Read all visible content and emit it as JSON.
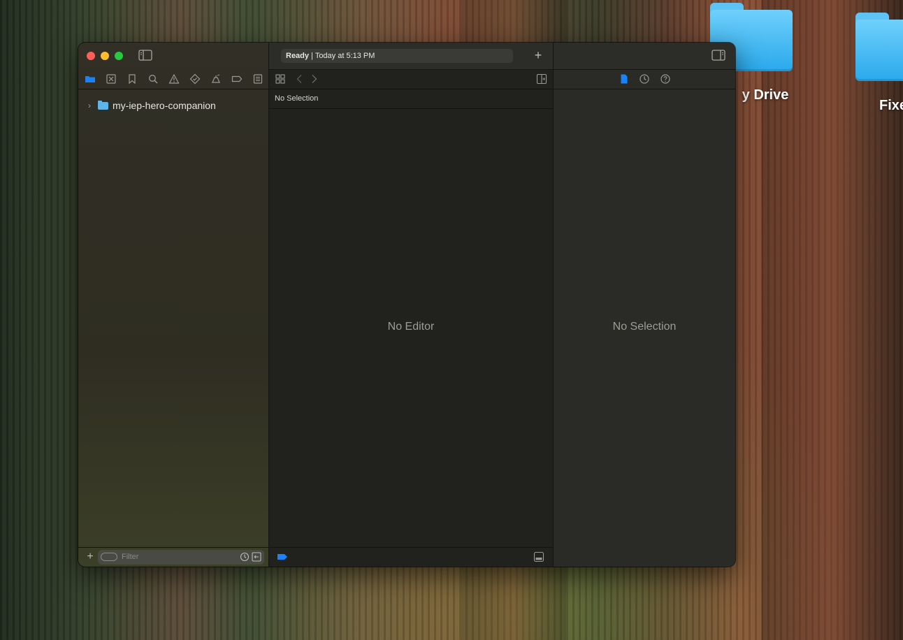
{
  "desktop": {
    "icons": [
      {
        "label": "y Drive"
      },
      {
        "label": "Fixe"
      }
    ]
  },
  "activity": {
    "status": "Ready",
    "separator": " | ",
    "time": "Today at 5:13 PM"
  },
  "navigator": {
    "project_name": "my-iep-hero-companion",
    "filter_placeholder": "Filter"
  },
  "editor": {
    "jumpbar_text": "No Selection",
    "placeholder": "No Editor"
  },
  "inspector": {
    "placeholder": "No Selection"
  },
  "colors": {
    "accent": "#1a82fb",
    "close": "#ff5f57",
    "minimize": "#febc2e",
    "zoom": "#28c840"
  }
}
